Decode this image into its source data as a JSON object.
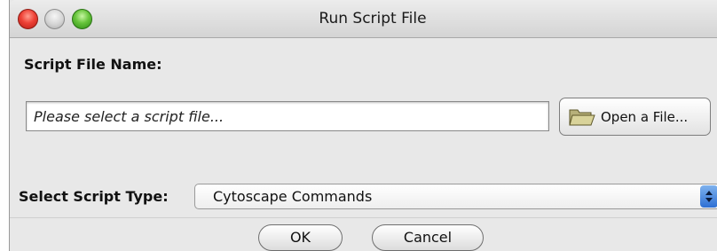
{
  "window": {
    "title": "Run Script File"
  },
  "form": {
    "script_file_label": "Script File Name:",
    "file_input_placeholder": "Please select a script file...",
    "file_input_value": "",
    "open_button_label": "Open a File...",
    "open_button_icon": "folder-open-icon",
    "script_type_label": "Select Script Type:",
    "script_type_selected": "Cytoscape Commands"
  },
  "actions": {
    "ok_label": "OK",
    "cancel_label": "Cancel"
  },
  "colors": {
    "close_button": "#ee4136",
    "zoom_button": "#67c43b",
    "select_arrow_accent": "#2d6fd3"
  }
}
